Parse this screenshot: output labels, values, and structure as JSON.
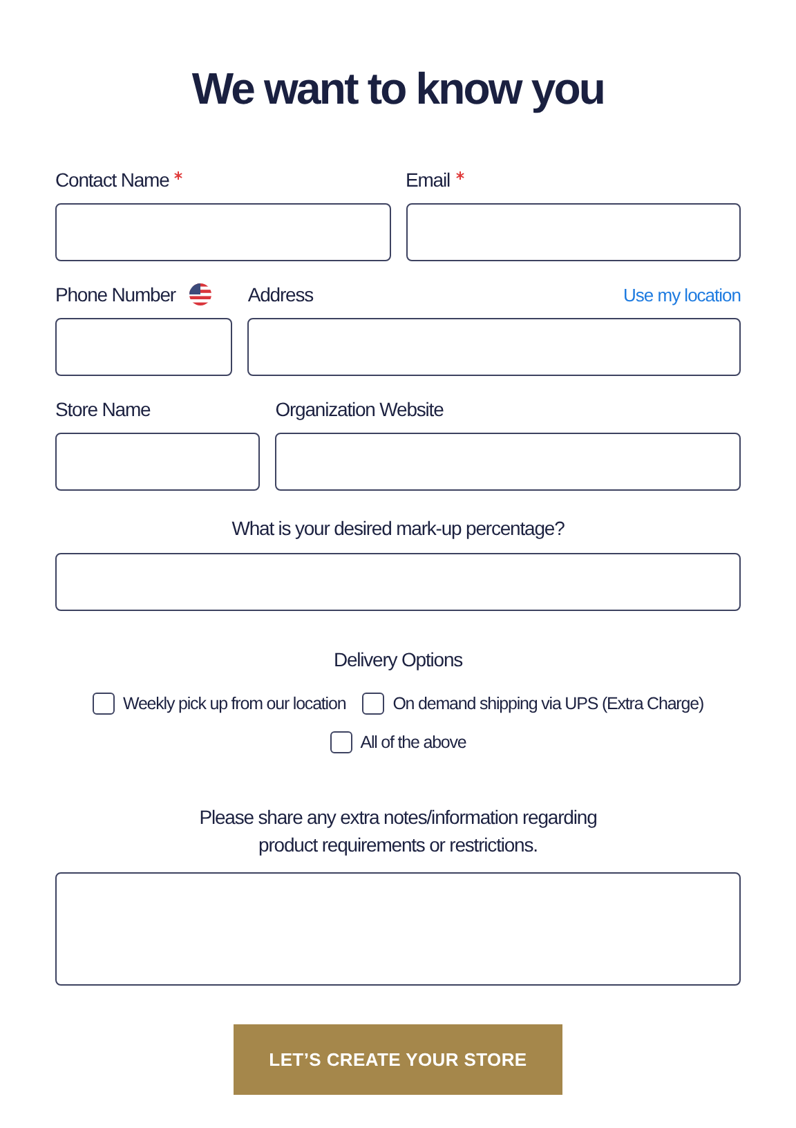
{
  "title": "We want to know you",
  "rows": [
    {
      "fields": [
        {
          "label": "Contact Name",
          "required": true,
          "kind": "text"
        },
        {
          "label": "Email",
          "required": true,
          "kind": "text"
        }
      ]
    },
    {
      "fields": [
        {
          "label": "Phone Number",
          "required": false,
          "kind": "phone"
        },
        {
          "label": "Address",
          "required": false,
          "kind": "text",
          "link": "Use my location"
        }
      ]
    },
    {
      "fields": [
        {
          "label": "Store Name",
          "required": false,
          "kind": "text"
        },
        {
          "label": "Organization Website",
          "required": false,
          "kind": "text"
        }
      ]
    }
  ],
  "markup": {
    "label": "What is your desired mark-up percentage?"
  },
  "delivery": {
    "label": "Delivery Options",
    "options": [
      {
        "label": "Weekly pick up from our location",
        "checked": false
      },
      {
        "label": "On demand shipping via UPS (Extra Charge)",
        "checked": false
      },
      {
        "label": "All of the above",
        "checked": false
      }
    ]
  },
  "notes": {
    "label": "Please share any extra notes/information regarding product requirements or restrictions."
  },
  "submit": "LET’S CREATE YOUR STORE"
}
